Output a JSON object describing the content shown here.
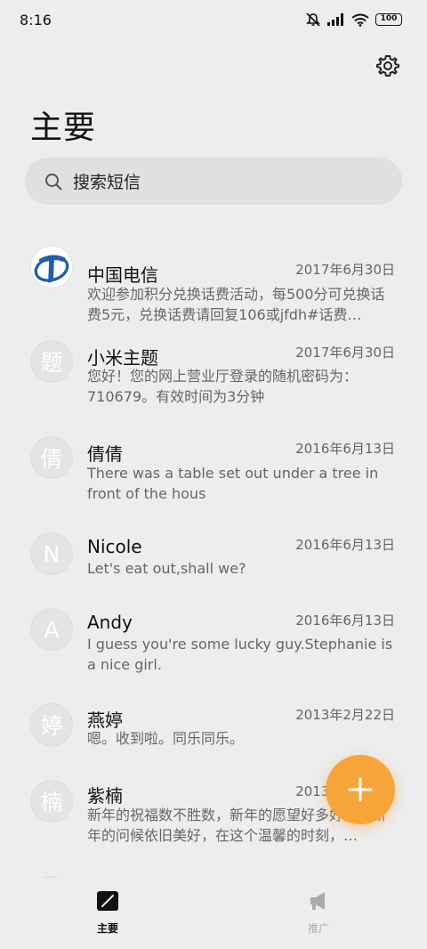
{
  "status_bar": {
    "time": "8:16",
    "battery": "100"
  },
  "header": {
    "title": "主要"
  },
  "search": {
    "placeholder": "搜索短信"
  },
  "messages": [
    {
      "sender": "中国电信",
      "date": "2017年6月30日",
      "preview": "欢迎参加积分兑换话费活动，每500分可兑换话费5元，兑换话费请回复106或jfdh#话费…",
      "avatar": ""
    },
    {
      "sender": "小米主题",
      "date": "2017年6月30日",
      "preview": "您好！您的网上营业厅登录的随机密码为：710679。有效时间为3分钟",
      "avatar": "题"
    },
    {
      "sender": "倩倩",
      "date": "2016年6月13日",
      "preview": "There was a table set out under a tree in front of the hous",
      "avatar": "倩"
    },
    {
      "sender": "Nicole",
      "date": "2016年6月13日",
      "preview": "Let's eat out,shall we?",
      "avatar": "N"
    },
    {
      "sender": "Andy",
      "date": "2016年6月13日",
      "preview": "I guess you're some lucky guy.Stephanie is a nice girl.",
      "avatar": "A"
    },
    {
      "sender": "燕婷",
      "date": "2013年2月22日",
      "preview": "嗯。收到啦。同乐同乐。",
      "avatar": "婷"
    },
    {
      "sender": "紫楠",
      "date": "2013年2月10日",
      "preview": "新年的祝福数不胜数，新年的愿望好多好多，新年的问候依旧美好，在这个温馨的时刻，…",
      "avatar": "楠"
    }
  ],
  "nav": {
    "home_label": "主要",
    "promo_label": "推广"
  },
  "colors": {
    "accent": "#f7a43a",
    "background": "#ededed",
    "telecom_blue": "#1f5fae"
  }
}
